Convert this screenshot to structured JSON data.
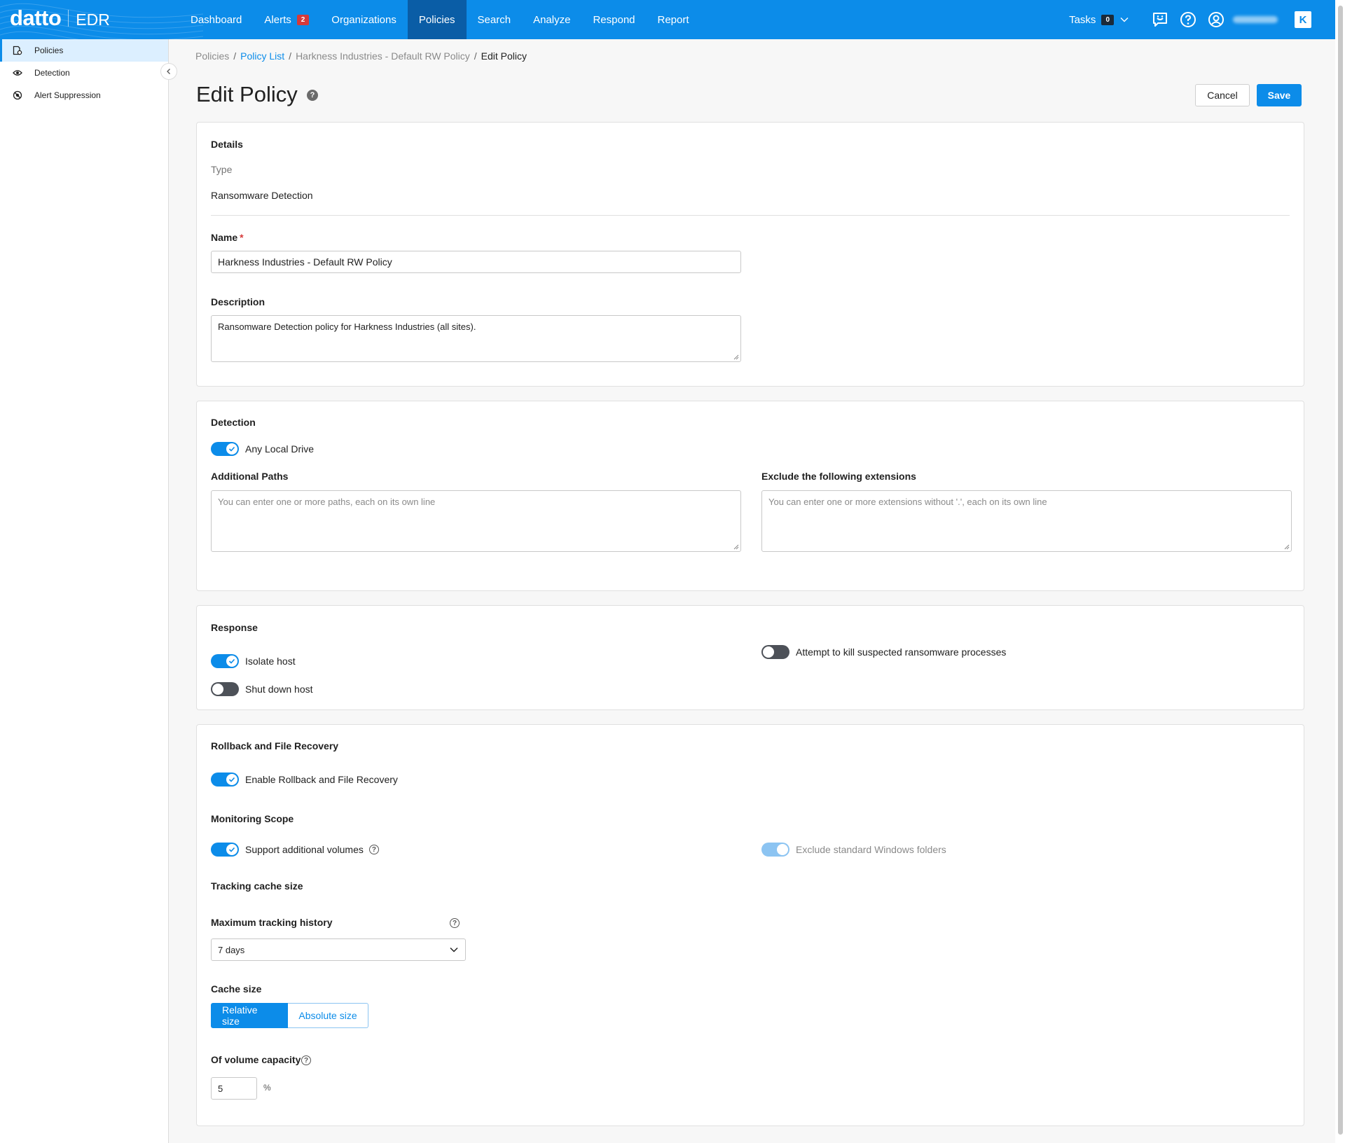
{
  "app": {
    "logo_word": "datto",
    "product": "EDR"
  },
  "nav": {
    "items": [
      {
        "label": "Dashboard"
      },
      {
        "label": "Alerts",
        "badge": "2"
      },
      {
        "label": "Organizations"
      },
      {
        "label": "Policies",
        "active": true
      },
      {
        "label": "Search"
      },
      {
        "label": "Analyze"
      },
      {
        "label": "Respond"
      },
      {
        "label": "Report"
      }
    ],
    "tasks_label": "Tasks",
    "tasks_count": "0"
  },
  "sidebar": {
    "items": [
      {
        "label": "Policies",
        "icon": "policy-icon",
        "active": true
      },
      {
        "label": "Detection",
        "icon": "eye-icon"
      },
      {
        "label": "Alert Suppression",
        "icon": "suppression-icon"
      }
    ]
  },
  "breadcrumb": {
    "items": [
      "Policies",
      "Policy List",
      "Harkness Industries - Default RW Policy",
      "Edit Policy"
    ],
    "separator": "/"
  },
  "header": {
    "title": "Edit Policy",
    "help_icon": "?",
    "cancel_label": "Cancel",
    "save_label": "Save"
  },
  "details": {
    "section_title": "Details",
    "type_label": "Type",
    "type_value": "Ransomware Detection",
    "name_label": "Name",
    "name_required": "*",
    "name_value": "Harkness Industries - Default RW Policy",
    "description_label": "Description",
    "description_value": "Ransomware Detection policy for Harkness Industries (all sites)."
  },
  "detection": {
    "section_title": "Detection",
    "any_local_drive_label": "Any Local Drive",
    "any_local_drive_on": true,
    "additional_paths_label": "Additional Paths",
    "additional_paths_placeholder": "You can enter one or more paths, each on its own line",
    "exclude_extensions_label": "Exclude the following extensions",
    "exclude_extensions_placeholder": "You can enter one or more extensions without '.', each on its own line"
  },
  "response": {
    "section_title": "Response",
    "isolate_host_label": "Isolate host",
    "isolate_host_on": true,
    "shutdown_host_label": "Shut down host",
    "shutdown_host_on": false,
    "kill_processes_label": "Attempt to kill suspected ransomware processes",
    "kill_processes_on": false
  },
  "rollback": {
    "section_title": "Rollback and File Recovery",
    "enable_label": "Enable Rollback and File Recovery",
    "enable_on": true,
    "monitoring_scope_title": "Monitoring Scope",
    "support_volumes_label": "Support additional volumes",
    "support_volumes_on": true,
    "exclude_windows_label": "Exclude standard Windows folders",
    "exclude_windows_on": true,
    "tracking_cache_title": "Tracking cache size",
    "max_history_label": "Maximum tracking history",
    "max_history_value": "7 days",
    "cache_size_label": "Cache size",
    "cache_size_options": [
      "Relative size",
      "Absolute size"
    ],
    "cache_size_selected": "Relative size",
    "volume_capacity_label": "Of volume capacity",
    "volume_capacity_value": "5",
    "volume_capacity_unit": "%"
  },
  "colors": {
    "brand": "#0c8ce9",
    "nav_active": "#0a5da6",
    "alert_badge": "#d63a3a",
    "toggle_off": "#4d5158"
  }
}
